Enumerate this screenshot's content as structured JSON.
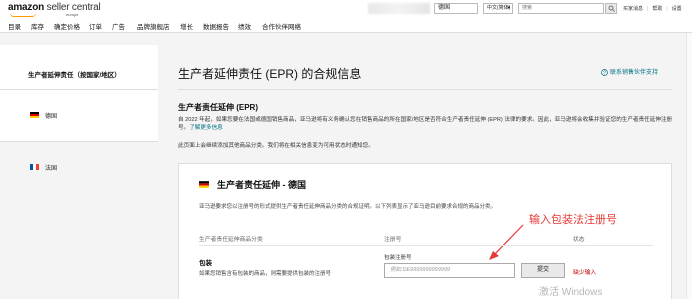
{
  "header": {
    "logo_text": "amazon",
    "logo_suffix": "seller central",
    "logo_region": "europe",
    "country": "德国",
    "language": "中文(简体)",
    "search_placeholder": "搜索",
    "links": [
      "买家消息",
      "帮助",
      "设置"
    ]
  },
  "nav": [
    "目录",
    "库存",
    "确定价格",
    "订单",
    "广告",
    "品牌旗舰店",
    "增长",
    "数据报告",
    "绩效",
    "合作伙伴网络"
  ],
  "sidebar": {
    "heading": "生产者延伸责任（按国家/地区）",
    "items": [
      {
        "label": "德国",
        "flag": "de-flag"
      },
      {
        "label": "法国",
        "flag": "fr-flag"
      }
    ]
  },
  "main": {
    "title": "生产者延伸责任 (EPR) 的合规信息",
    "contact_link": "联系销售伙伴支持",
    "section_title": "生产者责任延伸 (EPR)",
    "section_body": "自 2022 年起，如果您要在法国或德国销售商品，亚马逊将有义务确认您在销售商品的所在国家/地区是否符合生产者责任延伸 (EPR) 法律的要求。因此，亚马逊将会收集并验证您的生产者责任延伸注册号。",
    "learn_more": "了解更多信息",
    "section_note": "此页面上会继续添加其他商品分类。我们将在相关信息变为可用状态时通知您。",
    "card": {
      "title": "生产者责任延伸 - 德国",
      "flag": "de-flag",
      "description": "亚马逊要求您以注册号的形式提供生产者责任延伸商品分类的合规证明。以下列表显示了亚马逊目前要求合规的商品分类。",
      "columns": [
        "生产者责任延伸商品分类",
        "注册号",
        "状态"
      ],
      "category_title": "包装",
      "category_desc": "如果您销售含有包装的商品，则需要提供包装的注册号",
      "reg_label": "包装注册号",
      "reg_placeholder": "例如 DE9999999999999",
      "submit_label": "提交",
      "status": "缺少输入"
    }
  },
  "annotation": "输入包装法注册号",
  "watermark": "激活 Windows",
  "colors": {
    "link": "#007185",
    "annotation": "#e53935",
    "status_missing": "#c40000",
    "brand_orange": "#ff9900"
  }
}
